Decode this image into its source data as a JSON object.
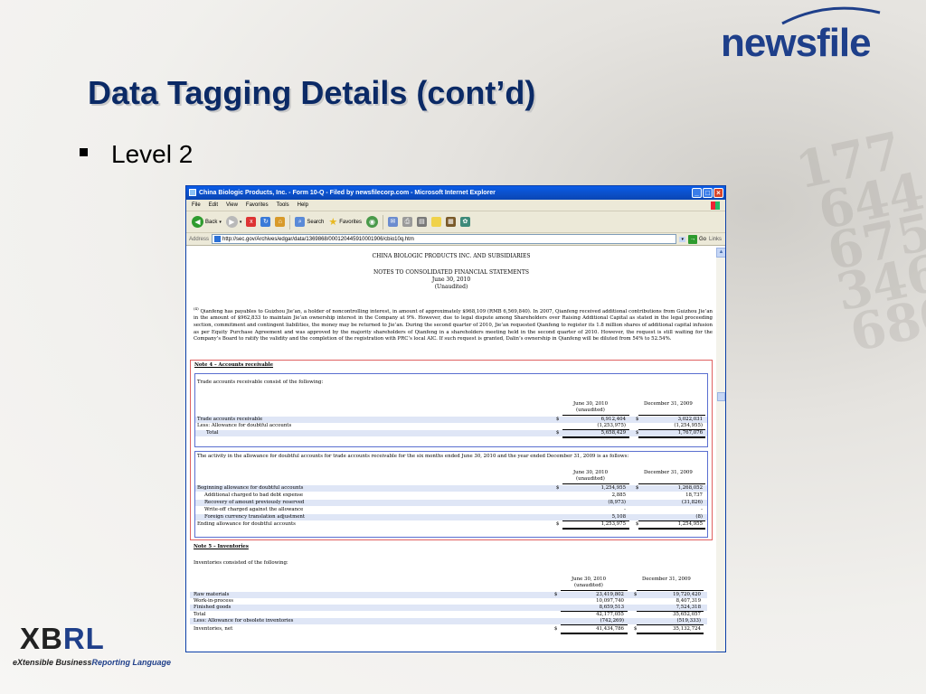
{
  "slide": {
    "title": "Data Tagging Details (cont’d)",
    "bullet": "Level 2",
    "background_numbers": [
      "177",
      "644",
      "675",
      "346",
      "680"
    ]
  },
  "brand": {
    "name": "newsfile",
    "accent_color": "#1e3f8a"
  },
  "xbrl_logo": {
    "name": "XBRL",
    "tagline_a": "eXtensible Business",
    "tagline_b": "Reporting Language"
  },
  "browser": {
    "title": "China Biologic Products, Inc. - Form 10-Q - Filed by newsfilecorp.com - Microsoft Internet Explorer",
    "menu": [
      "File",
      "Edit",
      "View",
      "Favorites",
      "Tools",
      "Help"
    ],
    "toolbar": {
      "back_label": "Back",
      "search_label": "Search",
      "favorites_label": "Favorites"
    },
    "address_label": "Address",
    "url": "http://sec.gov/Archives/edgar/data/1369868/000120445910001906/cbio10q.htm",
    "go_label": "Go",
    "links_label": "Links"
  },
  "document": {
    "company": "CHINA BIOLOGIC PRODUCTS INC. AND SUBSIDIARIES",
    "heading": "NOTES TO CONSOLIDATED FINANCIAL STATEMENTS",
    "date": "June 30, 2010",
    "unaudited": "(Unaudited)",
    "para_marker": "(4)",
    "paragraph": "Qianfeng has payables to Guizhou Jie’an, a holder of noncontrolling interest, in amount of approximately $968,109 (RMB 6,569,840). In 2007, Qianfeng received additional contributions from Guizhou Jie’an in the amount of $962,833 to maintain Jie’an ownership interest in the Company at 9%. However, due to legal dispute among Shareholders over Raising Additional Capital as stated in the legal proceeding section, commitment and contingent liabilities, the money may be returned to Jie’an. During the second quarter of 2010, Jie’an requested Qianfeng to register its 1.8 million shares of additional capital infusion as per Equity Purchase Agreement and was approved by the majority shareholders of Qianfeng in a shareholders meeting held in the second quarter of 2010. However, the request is still waiting for the Company’s Board to ratify the validity and the completion of the registration with PRC’s local AIC. If such request is granted, Dalin’s ownership in Qianfeng will be diluted from 54% to 52.54%.",
    "note4": {
      "title": "Note 4 – Accounts receivable",
      "intro": "Trade accounts receivable consist of the following:",
      "col1": "June 30, 2010",
      "col1_sub": "(unaudited)",
      "col2": "December 31, 2009",
      "currency": "$",
      "rows": [
        {
          "label": "Trade accounts receivable",
          "v1": "6,912,404",
          "v2": "3,022,031",
          "dollar": true
        },
        {
          "label": "Less: Allowance for doubtful accounts",
          "v1": "(1,253,975)",
          "v2": "(1,254,955)",
          "dollar": false
        },
        {
          "label": "Total",
          "v1": "5,658,429",
          "v2": "1,767,076",
          "dollar": true
        }
      ]
    },
    "allowance": {
      "intro": "The activity in the allowance for doubtful accounts for trade accounts receivable for the six months ended June 30, 2010 and the year ended December 31, 2009 is as follows:",
      "col1": "June 30, 2010",
      "col1_sub": "(unaudited)",
      "col2": "December 31, 2009",
      "rows": [
        {
          "label": "Beginning allowance for doubtful accounts",
          "v1": "1,254,955",
          "v2": "1,268,052",
          "dollar": true
        },
        {
          "label": "Additional charged to bad debt expense",
          "v1": "2,885",
          "v2": "18,737",
          "dollar": false
        },
        {
          "label": "Recovery of amount previously reserved",
          "v1": "(8,973)",
          "v2": "(31,826)",
          "dollar": false
        },
        {
          "label": "Write-off charged against the allowance",
          "v1": "-",
          "v2": "-",
          "dollar": false
        },
        {
          "label": "Foreign currency translation adjustment",
          "v1": "5,108",
          "v2": "(8)",
          "dollar": false
        },
        {
          "label": "Ending allowance for doubtful accounts",
          "v1": "1,253,975",
          "v2": "1,254,955",
          "dollar": true
        }
      ]
    },
    "note5": {
      "title": "Note 5 – Inventories",
      "intro": "Inventories consisted of the following:",
      "col1": "June 30, 2010",
      "col1_sub": "(unaudited)",
      "col2": "December 31, 2009",
      "rows": [
        {
          "label": "Raw materials",
          "v1": "23,419,802",
          "v2": "19,720,420",
          "dollar": true
        },
        {
          "label": "Work-in-process",
          "v1": "10,097,740",
          "v2": "8,407,319",
          "dollar": false
        },
        {
          "label": "Finished goods",
          "v1": "8,659,513",
          "v2": "7,524,318",
          "dollar": false
        },
        {
          "label": "Total",
          "v1": "42,177,055",
          "v2": "35,652,057",
          "dollar": false
        },
        {
          "label": "Less: Allowance for obsolete inventories",
          "v1": "(742,269)",
          "v2": "(519,333)",
          "dollar": false
        },
        {
          "label": "Inventories, net",
          "v1": "41,434,786",
          "v2": "35,132,724",
          "dollar": true
        }
      ]
    }
  }
}
